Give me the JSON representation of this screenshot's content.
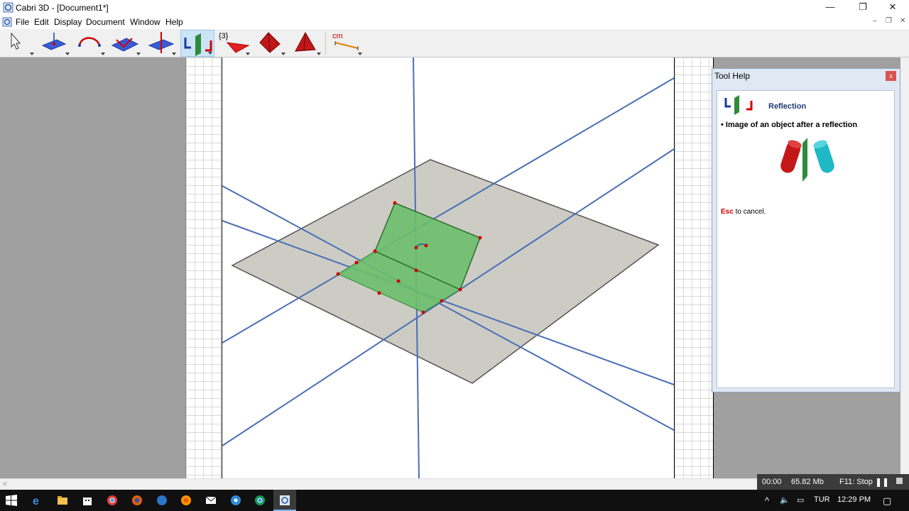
{
  "window": {
    "title": "Cabri 3D - [Document1*]",
    "controls": {
      "minimize": "—",
      "restore": "❐",
      "close": "✕"
    }
  },
  "menubar": {
    "items": [
      "File",
      "Edit",
      "Display",
      "Document",
      "Window",
      "Help"
    ],
    "mdi": {
      "minimize": "–",
      "restore": "❐",
      "close": "✕"
    }
  },
  "toolbar": {
    "tools": [
      {
        "name": "manipulation",
        "icon": "pointer-icon"
      },
      {
        "name": "points",
        "icon": "point-on-plane-icon"
      },
      {
        "name": "curves",
        "icon": "arc-icon"
      },
      {
        "name": "surfaces",
        "icon": "plane-icon"
      },
      {
        "name": "relative-constructions",
        "icon": "perpendicular-icon"
      },
      {
        "name": "transformations",
        "icon": "reflection-icon",
        "active": true
      },
      {
        "name": "regular-polygons",
        "icon": "polygon-icon",
        "label": "{3}"
      },
      {
        "name": "polyhedra",
        "icon": "polyhedron-icon"
      },
      {
        "name": "regular-polyhedra",
        "icon": "tetrahedron-icon"
      },
      {
        "name": "measurement",
        "icon": "measure-icon",
        "label": "cm"
      }
    ]
  },
  "tool_help": {
    "header": "Tool Help",
    "close": "x",
    "tool_name": "Reflection",
    "description": "• Image of an object after a reflection",
    "esc_key": "Esc",
    "esc_text": " to cancel."
  },
  "status": {
    "timer": "00:00",
    "memory": "65.82 Mb",
    "hotkey": "F11: Stop"
  },
  "taskbar": {
    "language": "TUR",
    "time": "12:29 PM"
  },
  "colors": {
    "plane": "#c9c8bf",
    "reflection_plane": "#6cbf6c",
    "axis": "#4a6fb5",
    "point": "#d00000"
  }
}
